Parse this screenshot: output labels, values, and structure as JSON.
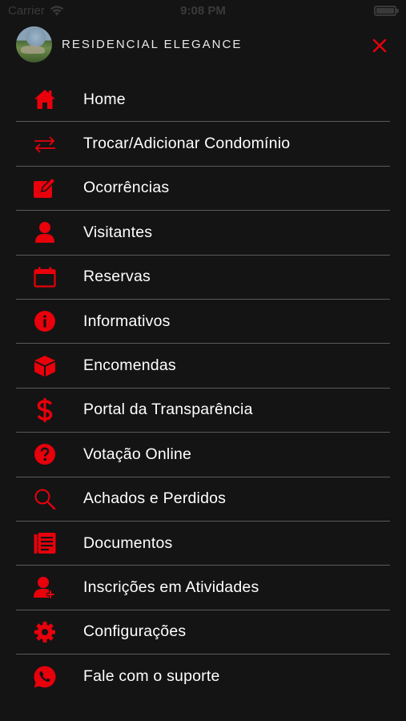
{
  "status_bar": {
    "carrier": "Carrier",
    "time": "9:08 PM"
  },
  "header": {
    "title": "RESIDENCIAL ELEGANCE"
  },
  "colors": {
    "accent": "#e8000b",
    "background": "#141414",
    "divider": "#5a5a5a"
  },
  "menu": {
    "items": [
      {
        "label": "Home",
        "icon": "home-icon"
      },
      {
        "label": "Trocar/Adicionar Condomínio",
        "icon": "swap-arrows-icon"
      },
      {
        "label": "Ocorrências",
        "icon": "edit-note-icon"
      },
      {
        "label": "Visitantes",
        "icon": "person-icon"
      },
      {
        "label": "Reservas",
        "icon": "calendar-icon"
      },
      {
        "label": "Informativos",
        "icon": "info-icon"
      },
      {
        "label": "Encomendas",
        "icon": "package-icon"
      },
      {
        "label": "Portal da Transparência",
        "icon": "dollar-icon"
      },
      {
        "label": "Votação Online",
        "icon": "question-icon"
      },
      {
        "label": "Achados e Perdidos",
        "icon": "search-icon"
      },
      {
        "label": "Documentos",
        "icon": "document-icon"
      },
      {
        "label": "Inscrições em Atividades",
        "icon": "person-add-icon"
      },
      {
        "label": "Configurações",
        "icon": "gear-icon"
      },
      {
        "label": "Fale com o suporte",
        "icon": "whatsapp-icon"
      }
    ]
  }
}
